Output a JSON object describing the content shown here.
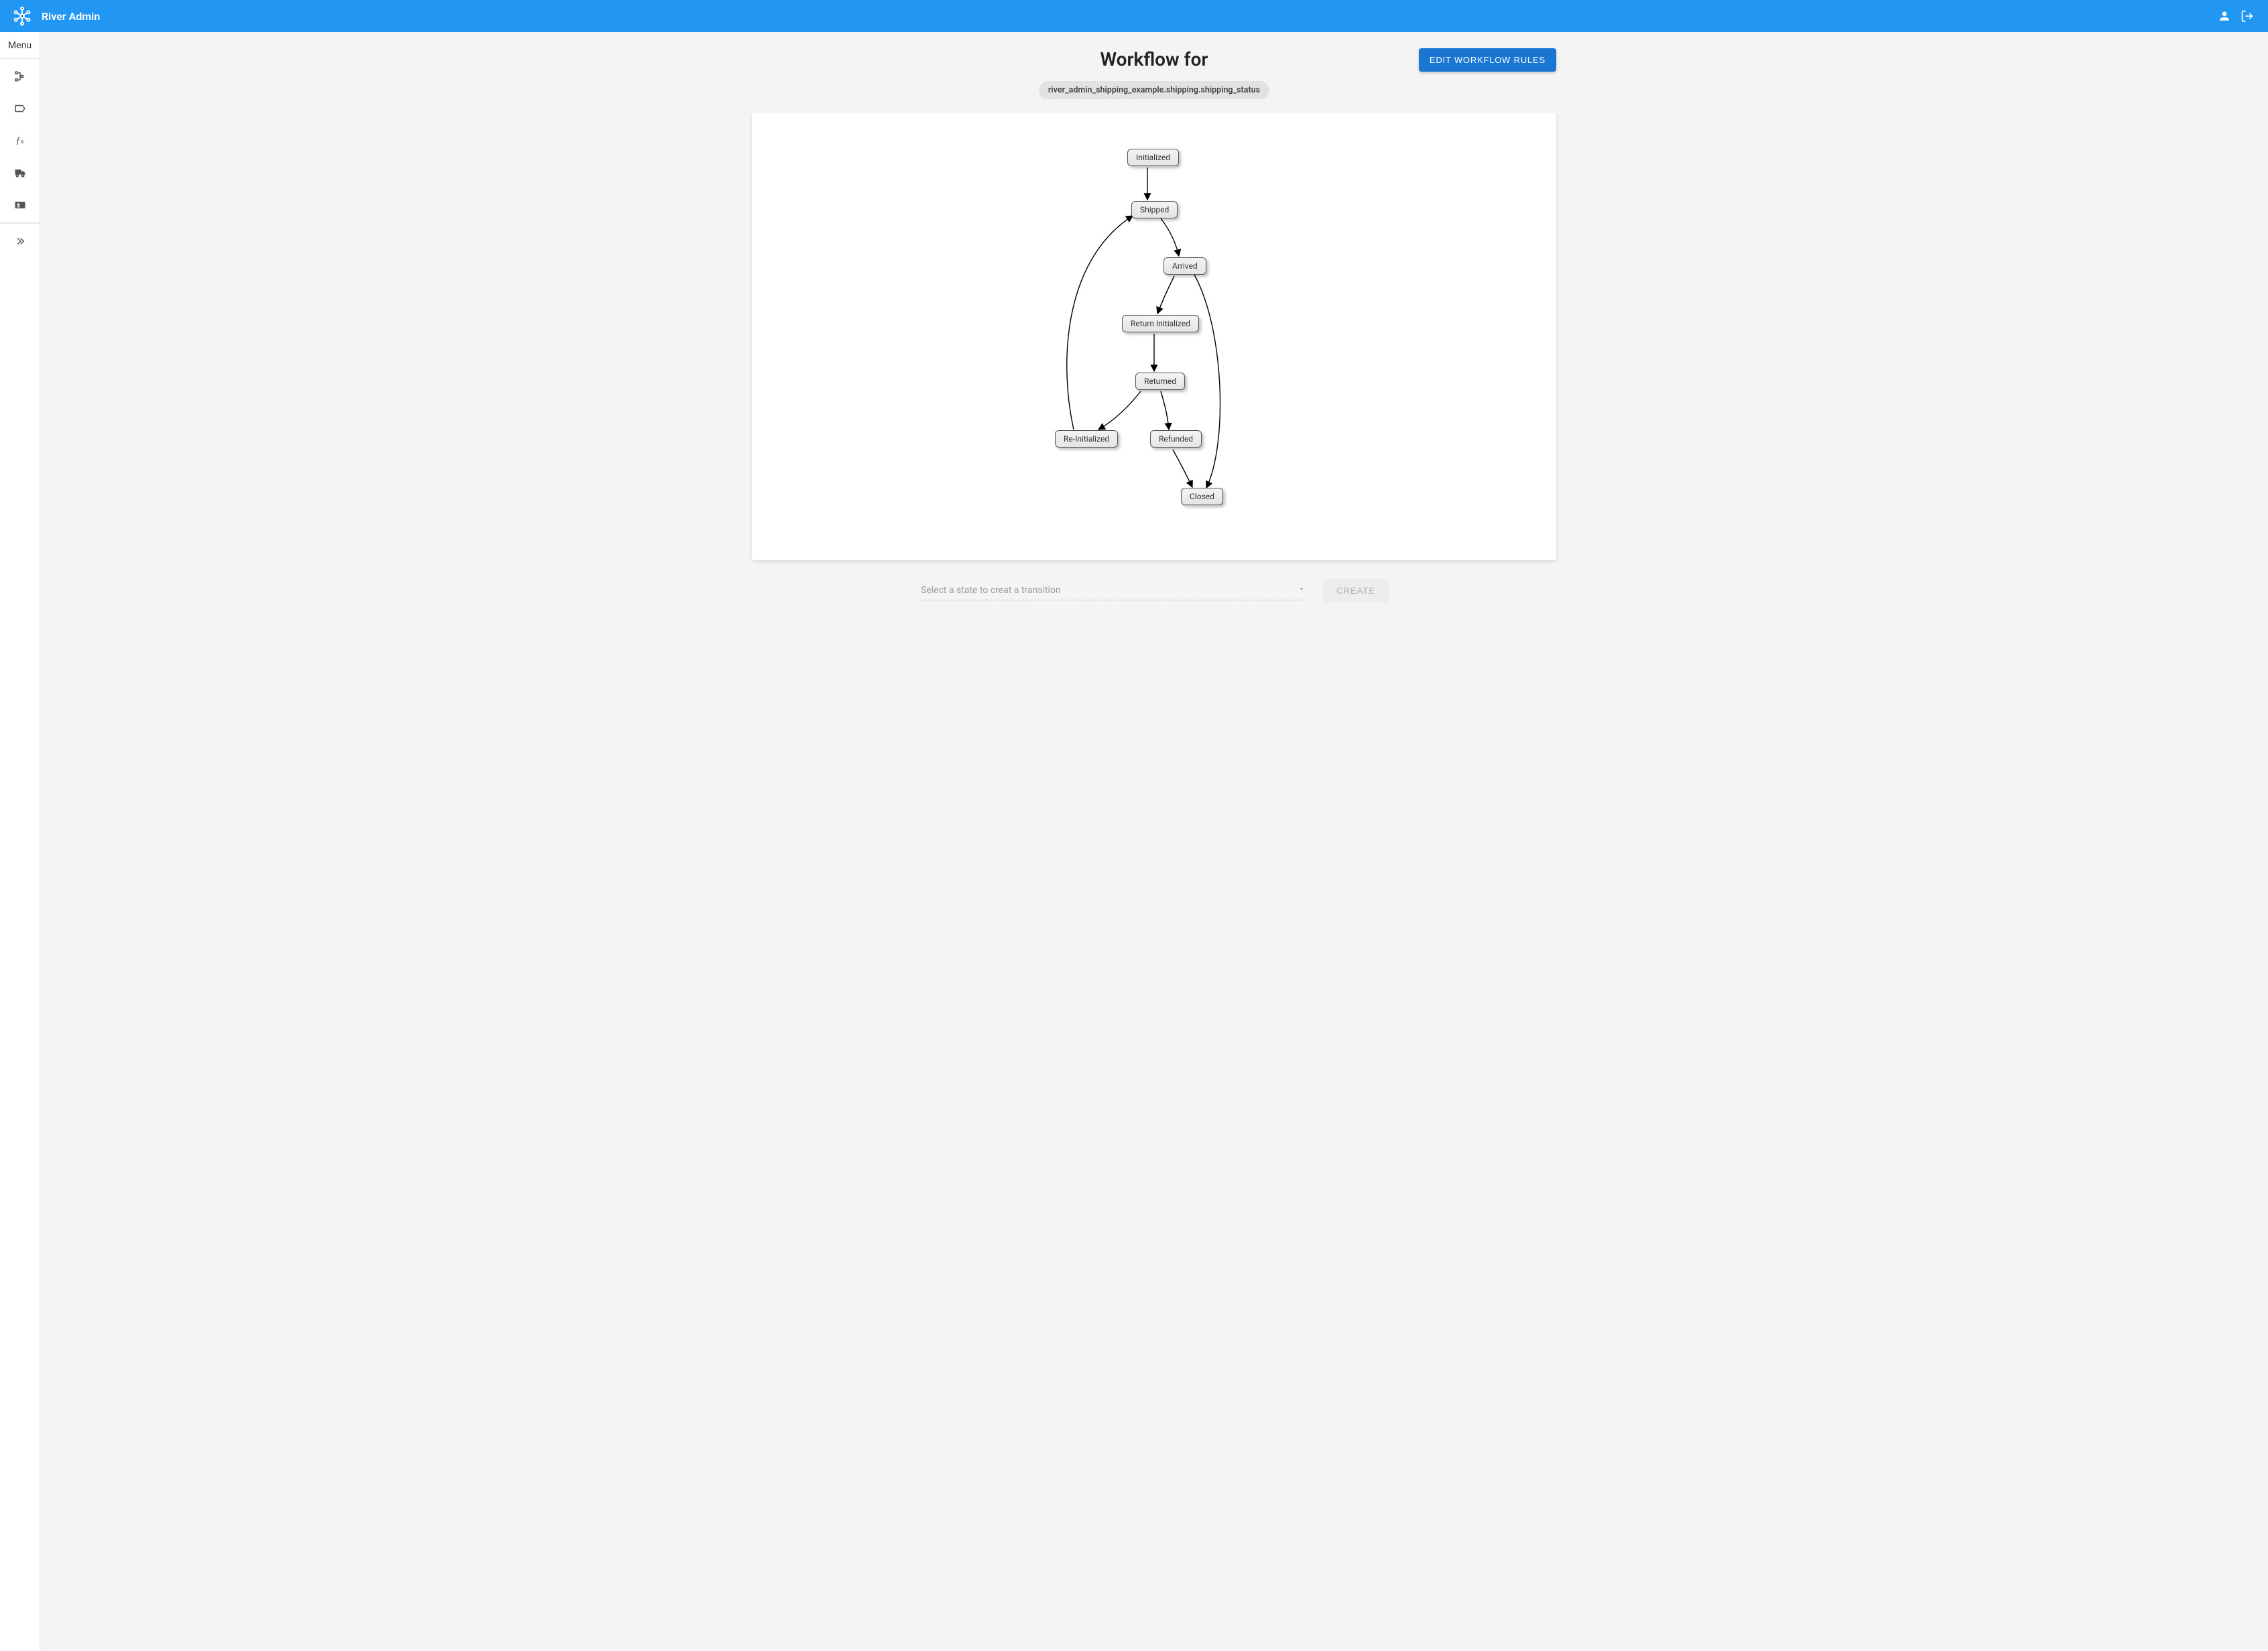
{
  "topbar": {
    "brand": "River Admin"
  },
  "sidebar": {
    "menu_label": "Menu",
    "items": [
      {
        "name": "tree-icon"
      },
      {
        "name": "tag-icon"
      },
      {
        "name": "fx-icon"
      },
      {
        "name": "truck-icon"
      },
      {
        "name": "id-card-icon"
      }
    ]
  },
  "page": {
    "title": "Workflow for",
    "workflow_path": "river_admin_shipping_example.shipping.shipping_status",
    "edit_rules_label": "EDIT WORKFLOW RULES"
  },
  "diagram": {
    "nodes": {
      "initialized": "Initialized",
      "shipped": "Shipped",
      "arrived": "Arrived",
      "return_initialized": "Return Initialized",
      "returned": "Returned",
      "re_initialized": "Re-Initialized",
      "refunded": "Refunded",
      "closed": "Closed"
    }
  },
  "form": {
    "state_placeholder": "Select a state to creat a transition",
    "create_label": "CREATE"
  }
}
